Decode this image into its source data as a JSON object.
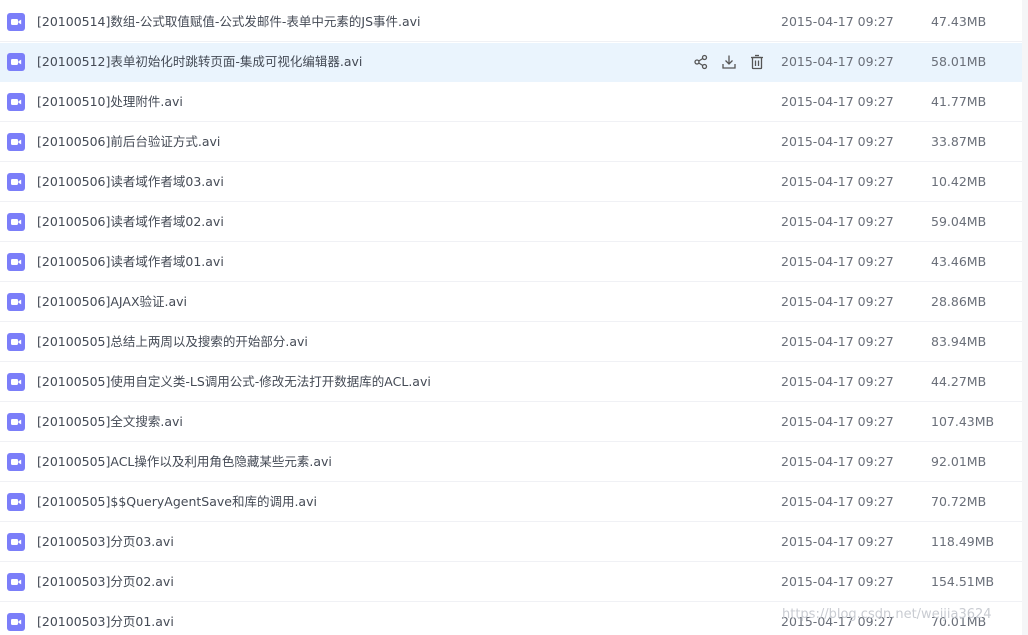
{
  "files": [
    {
      "name": "[20100514]数组-公式取值赋值-公式发邮件-表单中元素的JS事件.avi",
      "date": "2015-04-17 09:27",
      "size": "47.43MB"
    },
    {
      "name": "[20100512]表单初始化时跳转页面-集成可视化编辑器.avi",
      "date": "2015-04-17 09:27",
      "size": "58.01MB"
    },
    {
      "name": "[20100510]处理附件.avi",
      "date": "2015-04-17 09:27",
      "size": "41.77MB"
    },
    {
      "name": "[20100506]前后台验证方式.avi",
      "date": "2015-04-17 09:27",
      "size": "33.87MB"
    },
    {
      "name": "[20100506]读者域作者域03.avi",
      "date": "2015-04-17 09:27",
      "size": "10.42MB"
    },
    {
      "name": "[20100506]读者域作者域02.avi",
      "date": "2015-04-17 09:27",
      "size": "59.04MB"
    },
    {
      "name": "[20100506]读者域作者域01.avi",
      "date": "2015-04-17 09:27",
      "size": "43.46MB"
    },
    {
      "name": "[20100506]AJAX验证.avi",
      "date": "2015-04-17 09:27",
      "size": "28.86MB"
    },
    {
      "name": "[20100505]总结上两周以及搜索的开始部分.avi",
      "date": "2015-04-17 09:27",
      "size": "83.94MB"
    },
    {
      "name": "[20100505]使用自定义类-LS调用公式-修改无法打开数据库的ACL.avi",
      "date": "2015-04-17 09:27",
      "size": "44.27MB"
    },
    {
      "name": "[20100505]全文搜索.avi",
      "date": "2015-04-17 09:27",
      "size": "107.43MB"
    },
    {
      "name": "[20100505]ACL操作以及利用角色隐藏某些元素.avi",
      "date": "2015-04-17 09:27",
      "size": "92.01MB"
    },
    {
      "name": "[20100505]$$QueryAgentSave和库的调用.avi",
      "date": "2015-04-17 09:27",
      "size": "70.72MB"
    },
    {
      "name": "[20100503]分页03.avi",
      "date": "2015-04-17 09:27",
      "size": "118.49MB"
    },
    {
      "name": "[20100503]分页02.avi",
      "date": "2015-04-17 09:27",
      "size": "154.51MB"
    },
    {
      "name": "[20100503]分页01.avi",
      "date": "2015-04-17 09:27",
      "size": "70.01MB"
    }
  ],
  "hover_index": 1,
  "file_icon": "video-file-icon",
  "row_actions": [
    "share-icon",
    "download-icon",
    "delete-icon"
  ],
  "watermark": "https://blog.csdn.net/weijia3624",
  "colors": {
    "icon": "#7b7ef9",
    "hover_row": "#eaf4fd",
    "name_text": "#444a55",
    "meta_text": "#6a6f79",
    "action_icon": "#555555",
    "watermark": "#c9ccd2"
  }
}
